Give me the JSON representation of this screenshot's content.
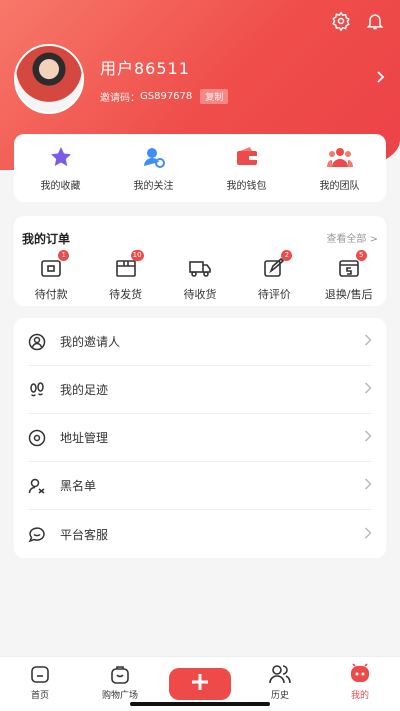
{
  "header": {
    "username": "用户86511",
    "invite_label": "邀请码：",
    "invite_code": "GS897678",
    "copy_label": "复制",
    "icons": [
      "gear-icon",
      "bell-icon",
      "chevron-right-icon"
    ]
  },
  "quick_links": [
    {
      "label": "我的收藏",
      "icon": "star-icon"
    },
    {
      "label": "我的关注",
      "icon": "user-follow-icon"
    },
    {
      "label": "我的钱包",
      "icon": "wallet-icon"
    },
    {
      "label": "我的团队",
      "icon": "team-icon"
    }
  ],
  "orders": {
    "title": "我的订单",
    "view_all": "查看全部 >",
    "items": [
      {
        "label": "待付款",
        "badge": "1",
        "icon": "payment-icon"
      },
      {
        "label": "待发货",
        "badge": "10",
        "icon": "package-icon"
      },
      {
        "label": "待收货",
        "badge": "",
        "icon": "truck-icon"
      },
      {
        "label": "待评价",
        "badge": "2",
        "icon": "review-icon"
      },
      {
        "label": "退换/售后",
        "badge": "5",
        "icon": "refund-icon"
      }
    ]
  },
  "menu": [
    {
      "label": "我的邀请人",
      "icon": "inviter-icon"
    },
    {
      "label": "我的足迹",
      "icon": "footprint-icon"
    },
    {
      "label": "地址管理",
      "icon": "location-icon"
    },
    {
      "label": "黑名单",
      "icon": "blacklist-icon"
    },
    {
      "label": "平台客服",
      "icon": "customer-service-icon"
    }
  ],
  "tabbar": [
    {
      "label": "首页",
      "icon": "home-icon"
    },
    {
      "label": "购物广场",
      "icon": "shopping-bag-icon"
    },
    {
      "label": "",
      "icon": "plus-icon"
    },
    {
      "label": "历史",
      "icon": "history-icon"
    },
    {
      "label": "我的",
      "icon": "profile-icon",
      "active": true
    }
  ],
  "colors": {
    "accent": "#ef4a4a",
    "header_gradient_start": "#f7786a",
    "header_gradient_end": "#ec4248"
  }
}
